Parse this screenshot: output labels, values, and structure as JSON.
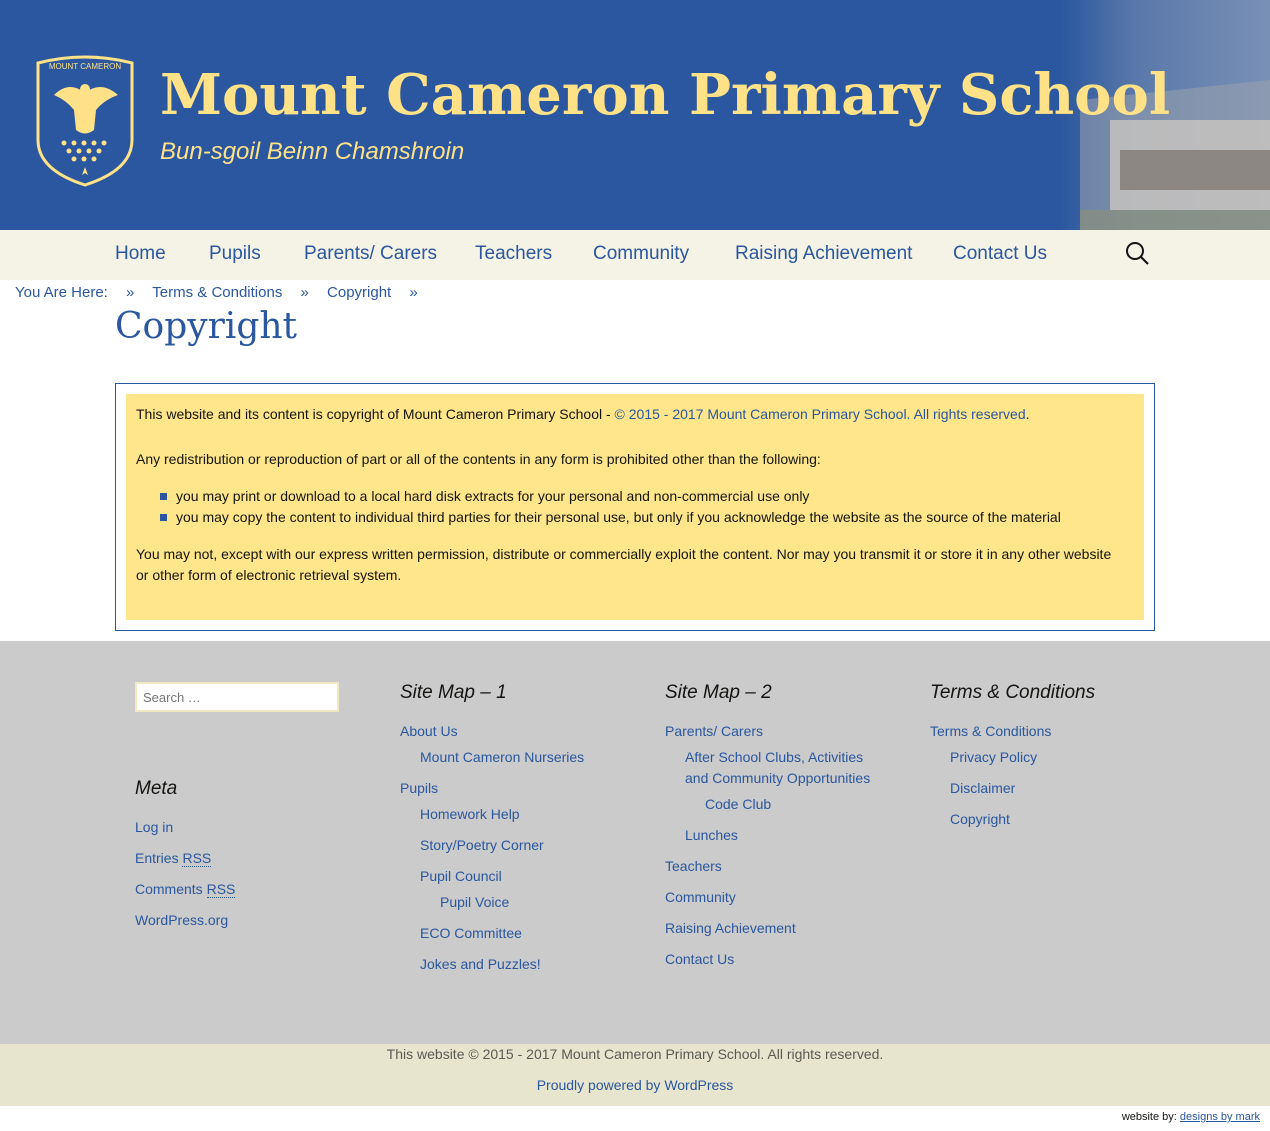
{
  "header": {
    "title": "Mount Cameron Primary School",
    "subtitle": "Bun-sgoil Beinn Chamshroin",
    "crest_text": "MOUNT CAMERON"
  },
  "nav": {
    "items": [
      "Home",
      "Pupils",
      "Parents/ Carers",
      "Teachers",
      "Community",
      "Raising Achievement",
      "Contact Us"
    ]
  },
  "breadcrumb": {
    "label": "You Are Here:",
    "sep": "»",
    "items": [
      "Terms & Conditions",
      "Copyright"
    ]
  },
  "page": {
    "title": "Copyright",
    "p1_text": "This website and its content is copyright of Mount Cameron Primary School - ",
    "p1_link": "© 2015 - 2017 Mount Cameron Primary School. All rights reserved",
    "p1_end": ".",
    "p2": "Any redistribution or reproduction of part or all of the contents in any form is prohibited other than the following:",
    "list": [
      "you may print or download to a local hard disk extracts for your personal and non-commercial use only",
      "you may copy the content to individual third parties for their personal use, but only if you acknowledge the website as the source of the material"
    ],
    "p3": "You may not, except with our express written permission, distribute or commercially exploit the content. Nor may you transmit it or store it in any other website or other form of electronic retrieval system."
  },
  "footer": {
    "search_placeholder": "Search …",
    "meta": {
      "title": "Meta",
      "login": "Log in",
      "entries": "Entries ",
      "comments": "Comments ",
      "rss": "RSS",
      "wordpress": "WordPress.org"
    },
    "sitemap1": {
      "title": "Site Map – 1",
      "about": "About Us",
      "nurseries": "Mount Cameron Nurseries",
      "pupils": "Pupils",
      "homework": "Homework Help",
      "story": "Story/Poetry Corner",
      "council": "Pupil Council",
      "voice": "Pupil Voice",
      "eco": "ECO Committee",
      "jokes": "Jokes and Puzzles!"
    },
    "sitemap2": {
      "title": "Site Map – 2",
      "parents": "Parents/ Carers",
      "clubs_1": "After School Clubs, Activities",
      "clubs_2": "and Community Opportunities",
      "code": "Code Club",
      "lunches": "Lunches",
      "teachers": "Teachers",
      "community": "Community",
      "raising": "Raising Achievement",
      "contact": "Contact Us"
    },
    "terms": {
      "title": "Terms & Conditions",
      "terms": "Terms & Conditions",
      "privacy": "Privacy Policy",
      "disclaimer": "Disclaimer",
      "copyright": "Copyright"
    }
  },
  "site_info": {
    "copyright": "This website © 2015 - 2017 Mount Cameron Primary School. All rights reserved.",
    "powered": "Proudly powered by WordPress",
    "credit_label": "website by: ",
    "credit_link": "designs by mark"
  },
  "colors": {
    "brand_blue": "#2a579f",
    "brand_yellow": "#ffe287",
    "content_yellow": "#ffe68a"
  },
  "icons": {
    "nav_search": "search-icon"
  }
}
